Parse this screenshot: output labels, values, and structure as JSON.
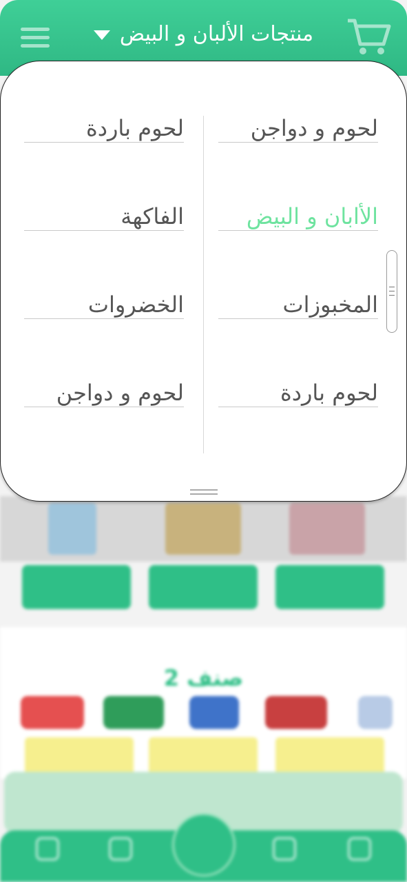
{
  "header": {
    "title": "منتجات الألبان و البيض",
    "menu_icon": "hamburger-menu-icon",
    "cart_icon": "shopping-cart-icon",
    "dropdown_icon": "caret-down-icon"
  },
  "categories": {
    "right_column": [
      "لحوم و دواجن",
      "الأابان و البيض",
      "المخبوزات",
      "لحوم باردة"
    ],
    "left_column": [
      "لحوم باردة",
      "الفاكهة",
      "الخضروات",
      "لحوم و دواجن"
    ],
    "active": "الأابان و البيض"
  },
  "background": {
    "section_title": "صنف 2"
  },
  "colors": {
    "primary": "#2fbf87",
    "active_item": "#6ee39f",
    "offer_yellow": "#f6ef8e"
  }
}
